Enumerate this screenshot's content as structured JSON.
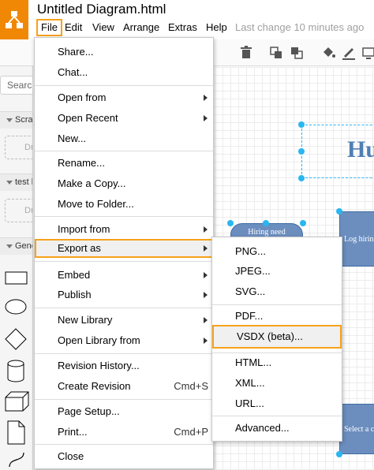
{
  "header": {
    "title": "Untitled Diagram.html",
    "last_change": "Last change 10 minutes ago",
    "menus": [
      "File",
      "Edit",
      "View",
      "Arrange",
      "Extras",
      "Help"
    ]
  },
  "sidebar": {
    "search_placeholder": "Search",
    "sections": [
      "Scratch",
      "test libr",
      "Genera"
    ],
    "drop_label": "Dr"
  },
  "canvas": {
    "title_text": "Hu",
    "node_hiring": "Hiring need",
    "node_log": "Log hirin",
    "node_select": "Select a c"
  },
  "file_menu": {
    "share": "Share...",
    "chat": "Chat...",
    "open_from": "Open from",
    "open_recent": "Open Recent",
    "new": "New...",
    "rename": "Rename...",
    "make_copy": "Make a Copy...",
    "move_folder": "Move to Folder...",
    "import_from": "Import from",
    "export_as": "Export as",
    "embed": "Embed",
    "publish": "Publish",
    "new_library": "New Library",
    "open_library": "Open Library from",
    "revision_history": "Revision History...",
    "create_revision": "Create Revision",
    "create_revision_shortcut": "Cmd+S",
    "page_setup": "Page Setup...",
    "print": "Print...",
    "print_shortcut": "Cmd+P",
    "close": "Close"
  },
  "export_menu": {
    "png": "PNG...",
    "jpeg": "JPEG...",
    "svg": "SVG...",
    "pdf": "PDF...",
    "vsdx": "VSDX (beta)...",
    "html": "HTML...",
    "xml": "XML...",
    "url": "URL...",
    "advanced": "Advanced..."
  },
  "colors": {
    "brand": "#f08705",
    "highlight_border": "#f7a21b",
    "selection": "#29b6f2",
    "node_fill": "#6c8ebf"
  }
}
